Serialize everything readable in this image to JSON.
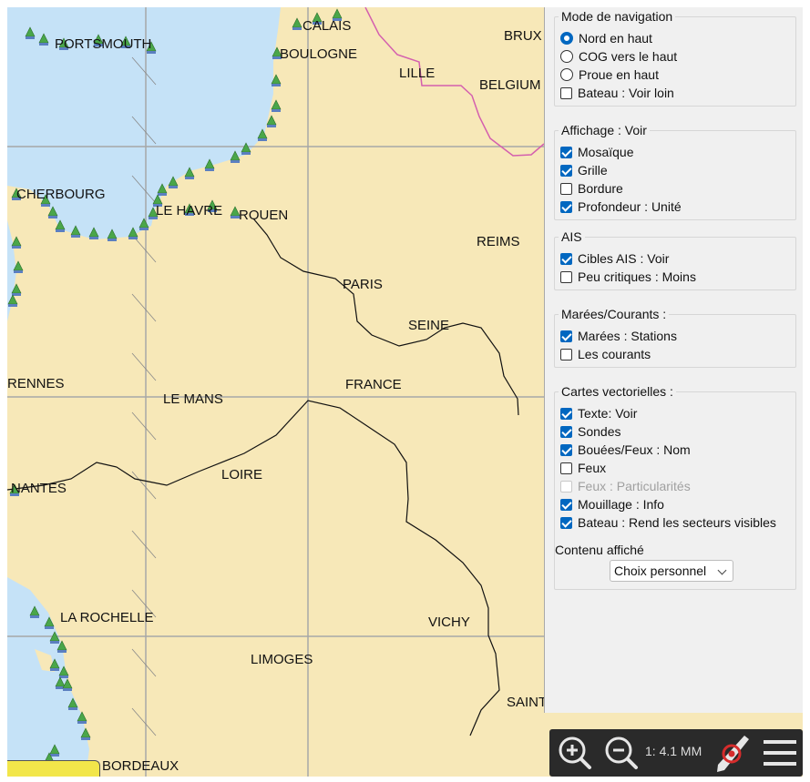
{
  "map": {
    "places": [
      {
        "name": "PORTSMOUTH"
      },
      {
        "name": "CALAIS"
      },
      {
        "name": "BOULOGNE"
      },
      {
        "name": "BRUX"
      },
      {
        "name": "LILLE"
      },
      {
        "name": "BELGIUM"
      },
      {
        "name": "CHERBOURG"
      },
      {
        "name": "LE HAVRE"
      },
      {
        "name": "ROUEN"
      },
      {
        "name": "REIMS"
      },
      {
        "name": "PARIS"
      },
      {
        "name": "SEINE"
      },
      {
        "name": "RENNES"
      },
      {
        "name": "LE MANS"
      },
      {
        "name": "FRANCE"
      },
      {
        "name": "LOIRE"
      },
      {
        "name": "NANTES"
      },
      {
        "name": "LA ROCHELLE"
      },
      {
        "name": "VICHY"
      },
      {
        "name": "LIMOGES"
      },
      {
        "name": "SAINT"
      },
      {
        "name": "BORDEAUX"
      }
    ],
    "colors": {
      "land": "#f7e8b8",
      "sea": "#c5e2f7",
      "grid": "#a7a7a7",
      "border": "#d45fae",
      "river": "#111111",
      "marker": "#4aa64a"
    }
  },
  "panel": {
    "navigation": {
      "title": "Mode de navigation",
      "options": [
        {
          "label": "Nord en haut",
          "type": "radio",
          "checked": true
        },
        {
          "label": "COG vers le haut",
          "type": "radio",
          "checked": false
        },
        {
          "label": "Proue en haut",
          "type": "radio",
          "checked": false
        },
        {
          "label": "Bateau : Voir loin",
          "type": "checkbox",
          "checked": false
        }
      ]
    },
    "display": {
      "title": "Affichage : Voir",
      "options": [
        {
          "label": "Mosaïque",
          "checked": true
        },
        {
          "label": "Grille",
          "checked": true
        },
        {
          "label": "Bordure",
          "checked": false
        },
        {
          "label": "Profondeur : Unité",
          "checked": true
        }
      ]
    },
    "ais": {
      "title": "AIS",
      "options": [
        {
          "label": "Cibles AIS : Voir",
          "checked": true
        },
        {
          "label": "Peu critiques : Moins",
          "checked": false
        }
      ]
    },
    "tides": {
      "title": "Marées/Courants :",
      "options": [
        {
          "label": "Marées : Stations",
          "checked": true
        },
        {
          "label": "Les courants",
          "checked": false
        }
      ]
    },
    "vector": {
      "title": "Cartes vectorielles :",
      "options": [
        {
          "label": "Texte: Voir",
          "checked": true,
          "disabled": false
        },
        {
          "label": "Sondes",
          "checked": true,
          "disabled": false
        },
        {
          "label": "Bouées/Feux : Nom",
          "checked": true,
          "disabled": false
        },
        {
          "label": "Feux",
          "checked": false,
          "disabled": false
        },
        {
          "label": "Feux : Particularités",
          "checked": false,
          "disabled": true
        },
        {
          "label": "Mouillage : Info",
          "checked": true,
          "disabled": false
        },
        {
          "label": "Bateau : Rend les secteurs visibles",
          "checked": true,
          "disabled": false
        }
      ]
    },
    "content": {
      "label": "Contenu affiché",
      "selected": "Choix personnel"
    }
  },
  "toolbar": {
    "scale": "1: 4.1 MM",
    "icons": [
      "zoom-in-icon",
      "zoom-out-icon",
      "boat-position-icon",
      "hamburger-menu-icon"
    ]
  }
}
